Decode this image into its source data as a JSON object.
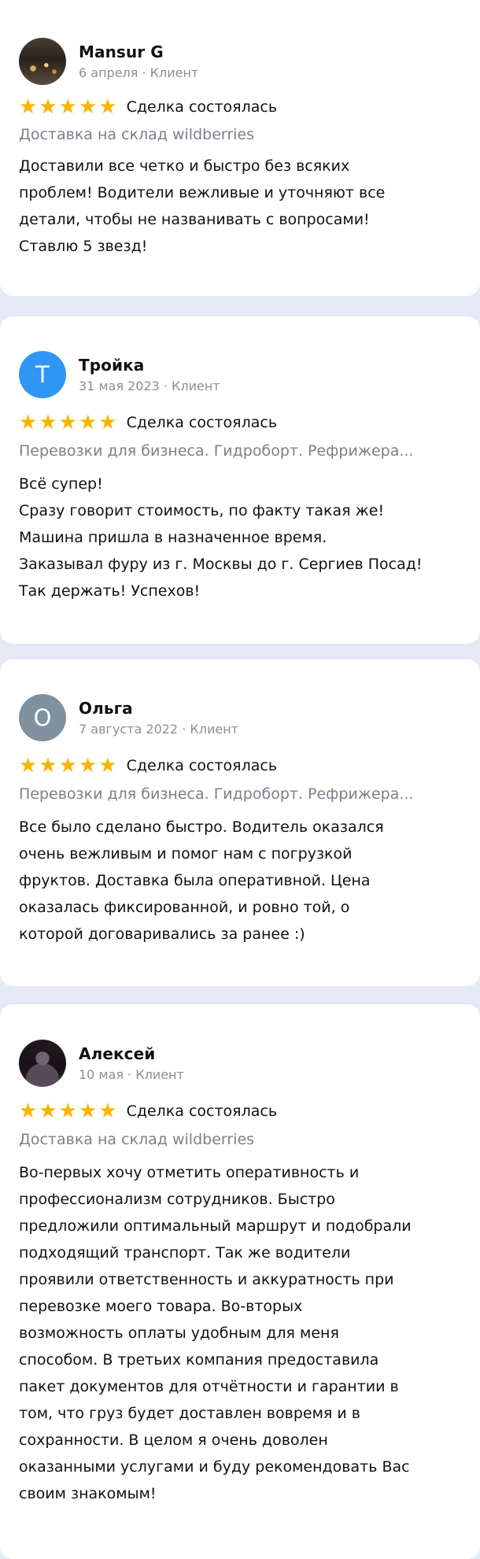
{
  "reviews": [
    {
      "author": "Mansur G",
      "avatar_letter": "",
      "date_line": "6 апреля · Клиент",
      "stars": 5,
      "status": "Сделка состоялась",
      "service": "Доставка на склад wildberries",
      "text": "Доставили все четко и быстро без всяких\nпроблем! Водители вежливые и уточняют все\nдетали, чтобы не названивать с вопросами!\nСтавлю 5 звезд!"
    },
    {
      "author": "Тройка",
      "avatar_letter": "Т",
      "date_line": "31 мая 2023 · Клиент",
      "stars": 5,
      "status": "Сделка состоялась",
      "service": "Перевозки для бизнеса. Гидроборт. Рефрижера...",
      "text": "Всё супер!\nСразу говорит стоимость, по факту такая же!\nМашина пришла в назначенное время.\nЗаказывал фуру из г. Москвы до г. Сергиев Посад!\nТак держать! Успехов!"
    },
    {
      "author": "Ольга",
      "avatar_letter": "О",
      "date_line": "7 августа 2022 · Клиент",
      "stars": 5,
      "status": "Сделка состоялась",
      "service": "Перевозки для бизнеса. Гидроборт. Рефрижера...",
      "text": "Все было сделано быстро. Водитель оказался\nочень вежливым и помог нам с погрузкой\nфруктов. Доставка была оперативной. Цена\nоказалась фиксированной, и ровно той, о\nкоторой договаривались за ранее :)"
    },
    {
      "author": "Алексей",
      "avatar_letter": "",
      "date_line": "10 мая · Клиент",
      "stars": 5,
      "status": "Сделка состоялась",
      "service": "Доставка на склад wildberries",
      "text": "Во-первых хочу отметить оперативность и\nпрофессионализм сотрудников. Быстро\nпредложили оптимальный маршрут и подобрали\nподходящий транспорт. Так же водители\nпроявили ответственность и аккуратность при\nперевозке моего товара. Во-вторых\nвозможность оплаты удобным для меня\nспособом. В третьих компания предоставила\nпакет документов для отчётности и гарантии в\nтом, что груз будет доставлен вовремя и в\nсохранности. В целом я очень доволен\nоказанными услугами и буду рекомендовать Вас\nсвоим знакомым!"
    }
  ],
  "colors": {
    "star": "#f7b500",
    "background": "#e4e9f5",
    "card": "#ffffff",
    "avatar_blue": "#2f96f3",
    "avatar_gray": "#7f919e"
  },
  "icons": {
    "star": "★"
  }
}
